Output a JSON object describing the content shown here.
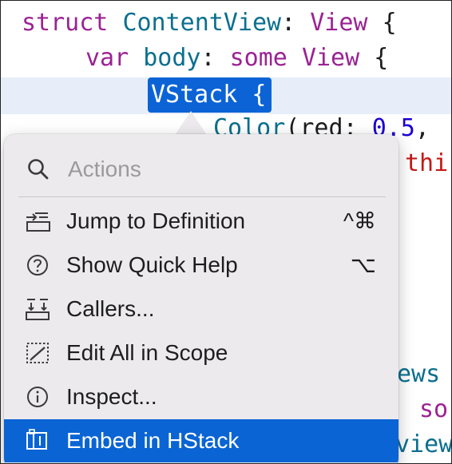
{
  "code": {
    "line1": {
      "kw": "struct",
      "type": "ContentView",
      "colon": ":",
      "proto": "View",
      "brace": "{"
    },
    "line2": {
      "kw": "var",
      "name": "body",
      "colon": ":",
      "some": "some",
      "proto": "View",
      "brace": "{"
    },
    "line3": {
      "selected": "VStack {"
    },
    "line4": {
      "type": "Color",
      "open": "(",
      "label": "red",
      "colon": ":",
      "value": "0.5",
      "comma": ","
    },
    "line5": {
      "partial": "thi"
    },
    "line6": {
      "partial": "ews"
    },
    "line7": {
      "partial": "so"
    },
    "line8": {
      "partial": "view"
    }
  },
  "actions_menu": {
    "search": {
      "placeholder": "Actions",
      "value": ""
    },
    "items": [
      {
        "label": "Jump to Definition",
        "shortcut": "^⌘",
        "icon": "jump-to-definition-icon"
      },
      {
        "label": "Show Quick Help",
        "shortcut": "⌥",
        "icon": "question-circle-icon"
      },
      {
        "label": "Callers...",
        "shortcut": "",
        "icon": "callers-icon"
      },
      {
        "label": "Edit All in Scope",
        "shortcut": "",
        "icon": "edit-scope-icon"
      },
      {
        "label": "Inspect...",
        "shortcut": "",
        "icon": "info-circle-icon"
      },
      {
        "label": "Embed in HStack",
        "shortcut": "",
        "icon": "embed-hstack-icon",
        "selected": true
      }
    ]
  },
  "colors": {
    "keyword": "#9b2393",
    "type": "#0b6f8f",
    "number": "#1c00cf",
    "string": "#c41a16",
    "selection": "#0a64d4"
  }
}
